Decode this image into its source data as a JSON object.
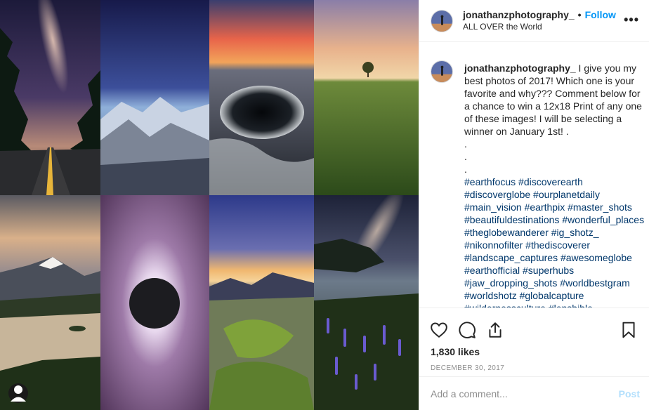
{
  "post": {
    "username": "jonathanzphotography_",
    "follow_label": "Follow",
    "separator": "•",
    "location": "ALL OVER the World",
    "more_label": "•••"
  },
  "caption": {
    "username": "jonathanzphotography_",
    "text": " I give you my best photos of 2017! Which one is your favorite and why??? Comment below for a chance to win a 12x18 Print of any one of these images! I will be selecting a winner on January 1st! .",
    "dots": [
      ".",
      ".",
      "."
    ],
    "hashtag_lines": [
      "#earthfocus #discoverearth",
      "#discoverglobe #ourplanetdaily",
      "#main_vision #earthpix #master_shots",
      "#beautifuldestinations #wonderful_places",
      "#theglobewanderer #ig_shotz_",
      "#nikonnofilter #thediscoverer",
      "#landscape_captures #awesomeglobe",
      "#earthofficial #superhubs",
      "#jaw_dropping_shots #worldbestgram",
      "#worldshotz #globalcapture",
      "#wildernessculture #lensbible"
    ]
  },
  "engagement": {
    "likes": "1,830 likes",
    "date": "DECEMBER 30, 2017"
  },
  "comment": {
    "placeholder": "Add a comment...",
    "post_label": "Post"
  },
  "icons": {
    "like": "heart-icon",
    "comment": "comment-bubble-icon",
    "share": "share-icon",
    "save": "bookmark-icon",
    "tag": "user-tag-icon"
  },
  "colors": {
    "link": "#0095f6",
    "hashtag": "#00376b",
    "post_disabled": "#b2dffc",
    "muted": "#8e8e8e"
  }
}
